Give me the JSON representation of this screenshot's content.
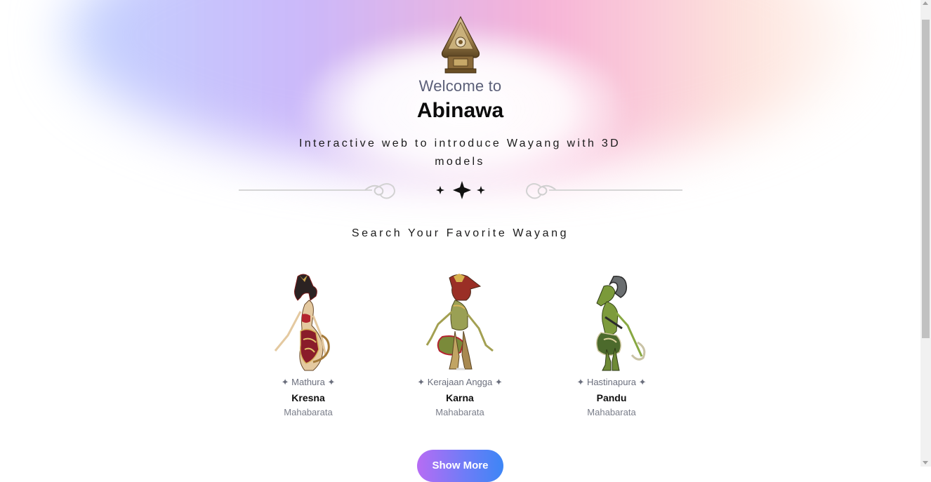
{
  "hero": {
    "welcome": "Welcome to",
    "brand": "Abinawa",
    "tagline": "Interactive web to introduce Wayang with 3D models"
  },
  "search": {
    "title": "Search Your Favorite Wayang"
  },
  "cards": [
    {
      "kingdom": "✦ Mathura ✦",
      "name": "Kresna",
      "epic": "Mahabarata"
    },
    {
      "kingdom": "✦ Kerajaan Angga ✦",
      "name": "Karna",
      "epic": "Mahabarata"
    },
    {
      "kingdom": "✦ Hastinapura ✦",
      "name": "Pandu",
      "epic": "Mahabarata"
    }
  ],
  "actions": {
    "show_more": "Show More"
  },
  "colors": {
    "accent_start": "#b76cf4",
    "accent_end": "#3d86f6",
    "muted_text": "#6b6f7d"
  }
}
